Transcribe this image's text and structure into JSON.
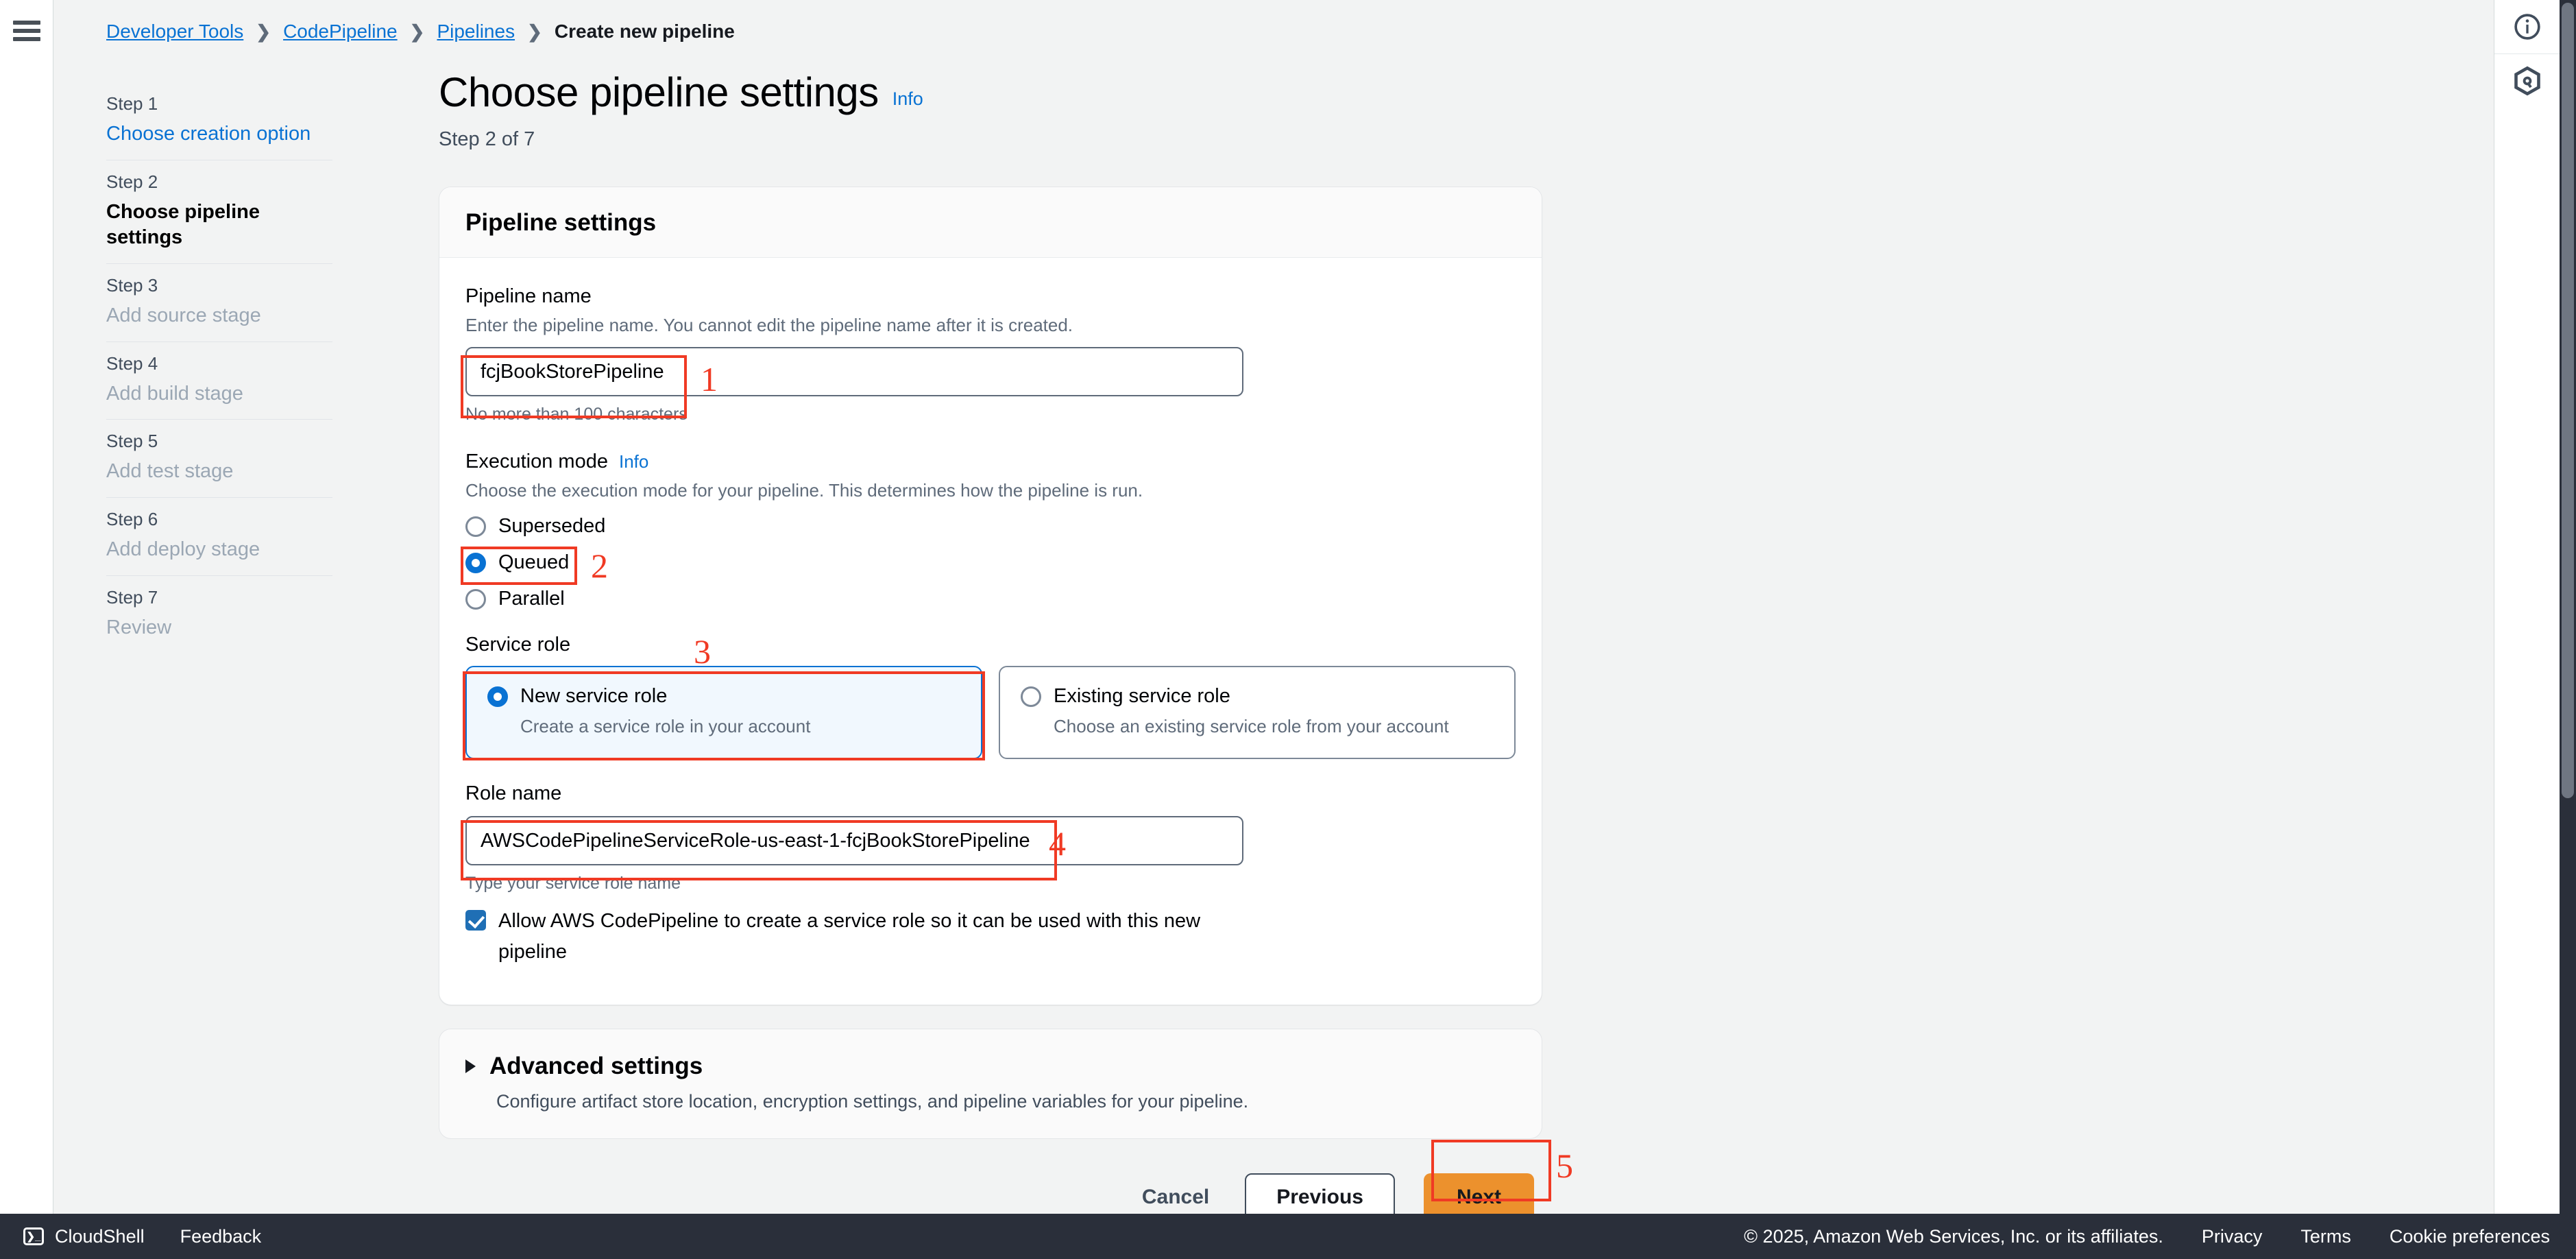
{
  "breadcrumb": {
    "items": [
      {
        "label": "Developer Tools",
        "type": "link"
      },
      {
        "label": "CodePipeline",
        "type": "link"
      },
      {
        "label": "Pipelines",
        "type": "link"
      },
      {
        "label": "Create new pipeline",
        "type": "current"
      }
    ],
    "separator": "❯"
  },
  "wizard": {
    "steps": [
      {
        "num": "Step 1",
        "label": "Choose creation option",
        "state": "link"
      },
      {
        "num": "Step 2",
        "label": "Choose pipeline settings",
        "state": "active"
      },
      {
        "num": "Step 3",
        "label": "Add source stage",
        "state": "muted"
      },
      {
        "num": "Step 4",
        "label": "Add build stage",
        "state": "muted"
      },
      {
        "num": "Step 5",
        "label": "Add test stage",
        "state": "muted"
      },
      {
        "num": "Step 6",
        "label": "Add deploy stage",
        "state": "muted"
      },
      {
        "num": "Step 7",
        "label": "Review",
        "state": "muted"
      }
    ]
  },
  "page": {
    "title": "Choose pipeline settings",
    "info_link": "Info",
    "step_indicator": "Step 2 of 7"
  },
  "settings_card": {
    "header": "Pipeline settings",
    "pipeline_name": {
      "label": "Pipeline name",
      "description": "Enter the pipeline name. You cannot edit the pipeline name after it is created.",
      "value": "fcjBookStorePipeline",
      "hint": "No more than 100 characters"
    },
    "execution_mode": {
      "label": "Execution mode",
      "info_link": "Info",
      "description": "Choose the execution mode for your pipeline. This determines how the pipeline is run.",
      "options": [
        {
          "label": "Superseded",
          "selected": false
        },
        {
          "label": "Queued",
          "selected": true
        },
        {
          "label": "Parallel",
          "selected": false
        }
      ]
    },
    "service_role": {
      "label": "Service role",
      "options": [
        {
          "title": "New service role",
          "description": "Create a service role in your account",
          "selected": true
        },
        {
          "title": "Existing service role",
          "description": "Choose an existing service role from your account",
          "selected": false
        }
      ]
    },
    "role_name": {
      "label": "Role name",
      "value": "AWSCodePipelineServiceRole-us-east-1-fcjBookStorePipeline",
      "hint": "Type your service role name",
      "checkbox_label": "Allow AWS CodePipeline to create a service role so it can be used with this new pipeline",
      "checkbox_checked": true
    }
  },
  "advanced_settings": {
    "title": "Advanced settings",
    "description": "Configure artifact store location, encryption settings, and pipeline variables for your pipeline.",
    "expanded": false
  },
  "actions": {
    "cancel": "Cancel",
    "previous": "Previous",
    "next": "Next"
  },
  "annotations": {
    "one": "1",
    "two": "2",
    "three": "3",
    "four": "4",
    "five": "5",
    "color": "#f03a24"
  },
  "bottom_bar": {
    "cloudshell": "CloudShell",
    "cloudshell_icon_glyph": "❯_",
    "feedback": "Feedback",
    "copyright": "© 2025, Amazon Web Services, Inc. or its affiliates.",
    "privacy": "Privacy",
    "terms": "Terms",
    "cookie_preferences": "Cookie preferences"
  },
  "right_rail": {
    "info_icon": "info-circle-icon",
    "q_icon": "amazon-q-hexagon-icon"
  },
  "colors": {
    "accent_blue": "#0972d3",
    "primary_button": "#ec912d",
    "annotation_red": "#f03a24",
    "dark_bar": "#2a2f3a"
  }
}
